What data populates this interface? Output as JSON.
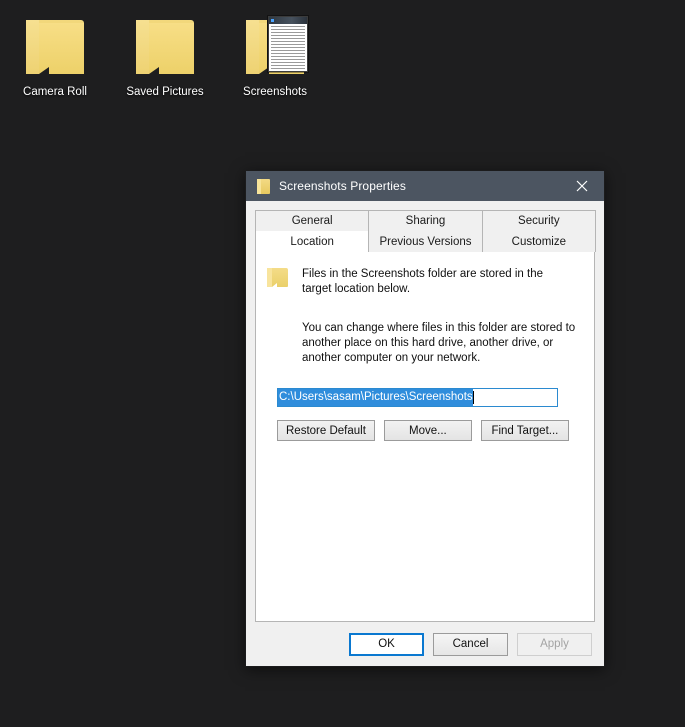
{
  "desktop": {
    "background_color": "#1e1e1f",
    "icons": [
      {
        "label": "Camera Roll",
        "icon": "folder-icon"
      },
      {
        "label": "Saved Pictures",
        "icon": "folder-icon"
      },
      {
        "label": "Screenshots",
        "icon": "folder-with-screenshot-thumbnail-icon"
      }
    ]
  },
  "dialog": {
    "title": "Screenshots Properties",
    "title_icon": "folder-icon",
    "titlebar_color": "#4c5561",
    "close_label": "✕",
    "tabs": {
      "row1": [
        {
          "label": "General",
          "active": false
        },
        {
          "label": "Sharing",
          "active": false
        },
        {
          "label": "Security",
          "active": false
        }
      ],
      "row2": [
        {
          "label": "Location",
          "active": true
        },
        {
          "label": "Previous Versions",
          "active": false
        },
        {
          "label": "Customize",
          "active": false
        }
      ]
    },
    "content": {
      "intro_line1": "Files in the Screenshots folder are stored in the",
      "intro_line2": "target location below.",
      "description": "You can change where files in this folder are stored to another place on this hard drive, another drive, or another computer on your network.",
      "path_value": "C:\\Users\\sasam\\Pictures\\Screenshots",
      "path_selected": true,
      "selection_color": "#2f8ddc",
      "focus_border_color": "#2b8ad0",
      "buttons": [
        {
          "label": "Restore Default",
          "enabled": true
        },
        {
          "label": "Move...",
          "enabled": true
        },
        {
          "label": "Find Target...",
          "enabled": true
        }
      ]
    },
    "footer": {
      "ok_label": "OK",
      "cancel_label": "Cancel",
      "apply_label": "Apply",
      "apply_enabled": false,
      "default_button": "OK",
      "default_border_color": "#0a78d0"
    }
  }
}
